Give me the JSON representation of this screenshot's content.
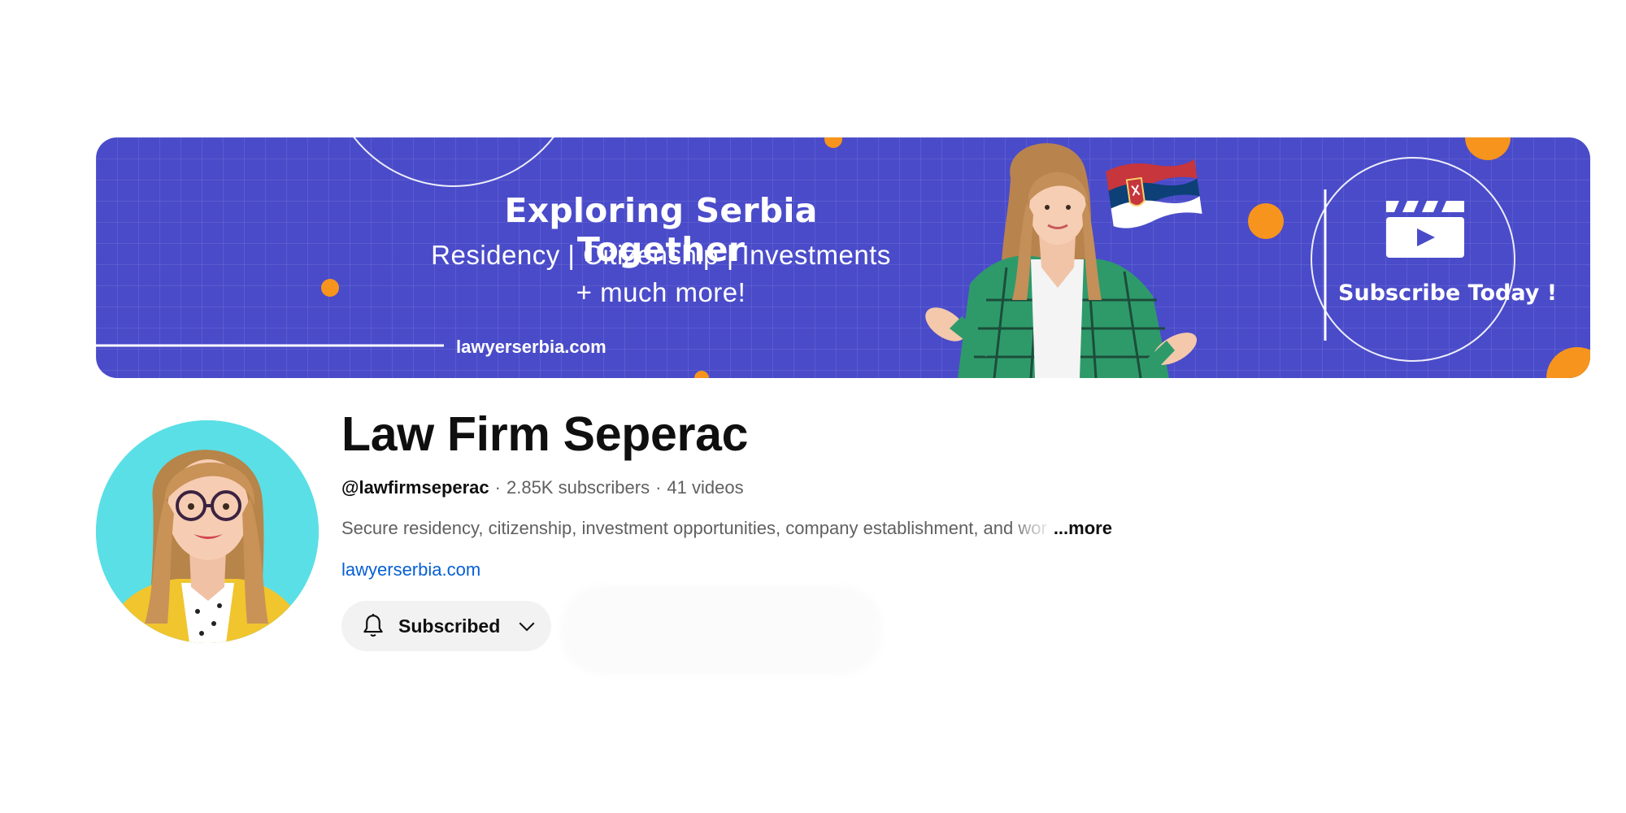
{
  "banner": {
    "title": "Exploring Serbia Together",
    "subtitle": "Residency | Citizenship | Investments",
    "subtitle2": "+ much more!",
    "url": "lawyerserbia.com",
    "cta": "Subscribe Today !",
    "bg_color": "#4a4bc9",
    "accent_color": "#f7941d"
  },
  "channel": {
    "name": "Law Firm Seperac",
    "handle": "@lawfirmseperac",
    "subscribers": "2.85K subscribers",
    "videos": "41 videos",
    "separator": "·",
    "description": "Secure residency, citizenship, investment opportunities, company establishment, and",
    "description_fade": " wor",
    "more_label": "...more",
    "link": "lawyerserbia.com",
    "avatar_bg": "#5adfe6"
  },
  "subscribe_button": {
    "label": "Subscribed",
    "icon": "bell-icon",
    "dropdown_icon": "chevron-down-icon"
  }
}
